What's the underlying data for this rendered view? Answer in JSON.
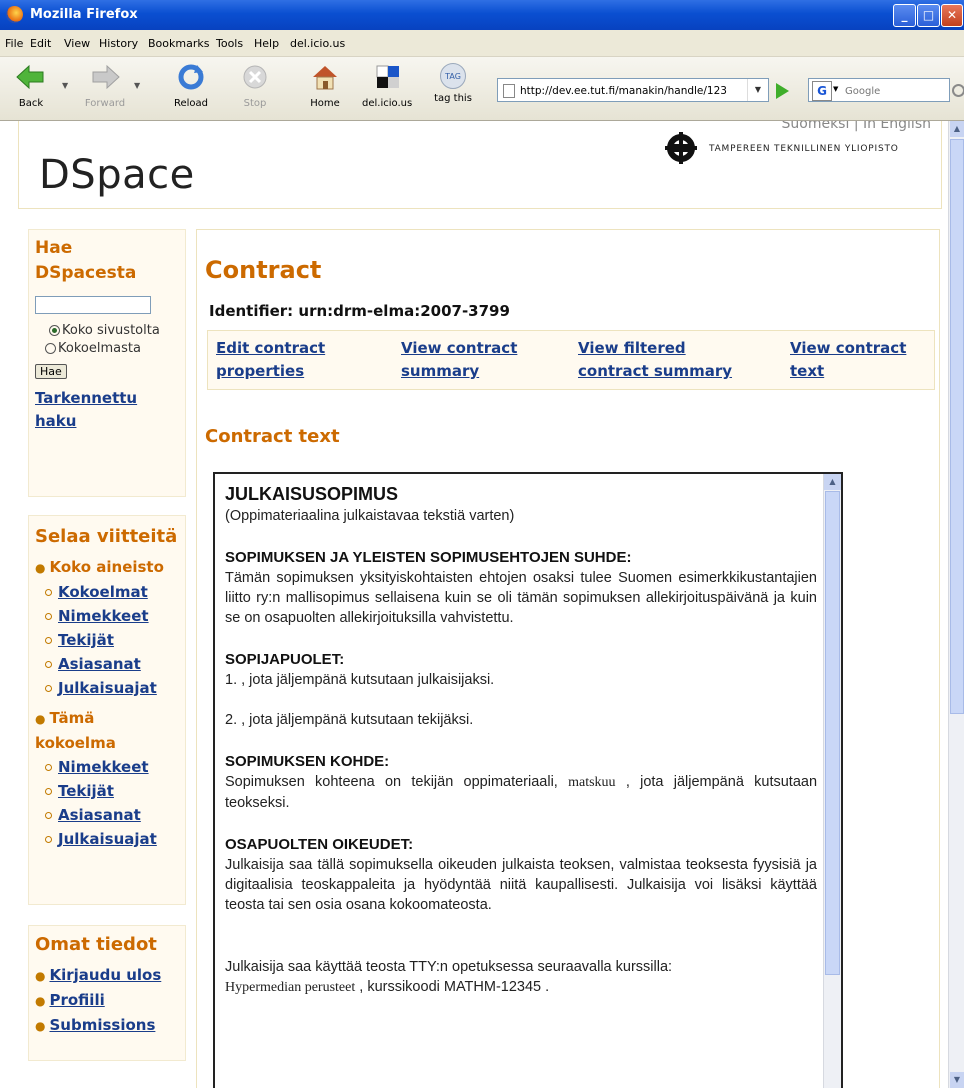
{
  "window": {
    "title": "Mozilla Firefox"
  },
  "menu": [
    "File",
    "Edit",
    "View",
    "History",
    "Bookmarks",
    "Tools",
    "Help",
    "del.icio.us"
  ],
  "toolbar": {
    "back": "Back",
    "forward": "Forward",
    "reload": "Reload",
    "stop": "Stop",
    "home": "Home",
    "delicious": "del.icio.us",
    "tag": "tag this",
    "tag_icon_text": "TAG",
    "url": "http://dev.ee.tut.fi/manakin/handle/123",
    "search_placeholder": "Google",
    "search_engine_letter": "G"
  },
  "header": {
    "languages": "Suomeksi | In English",
    "site_name": "DSpace",
    "institution": "TAMPEREEN TEKNILLINEN YLIOPISTO"
  },
  "sidebar": {
    "search": {
      "title": "Hae DSpacesta",
      "option_all": "Koko sivustolta",
      "option_collection": "Kokoelmasta",
      "button": "Hae",
      "advanced": "Tarkennettu haku"
    },
    "browse": {
      "title": "Selaa viitteitä",
      "groups": [
        {
          "label": "Koko aineisto",
          "items": [
            "Kokoelmat",
            "Nimekkeet",
            "Tekijät",
            "Asiasanat",
            "Julkaisuajat"
          ]
        },
        {
          "label": "Tämä kokoelma",
          "items": [
            "Nimekkeet",
            "Tekijät",
            "Asiasanat",
            "Julkaisuajat"
          ]
        }
      ]
    },
    "account": {
      "title": "Omat tiedot",
      "items": [
        "Kirjaudu ulos",
        "Profiili",
        "Submissions"
      ]
    }
  },
  "main": {
    "title": "Contract",
    "identifier": "Identifier: urn:drm-elma:2007-3799",
    "actions": {
      "edit": "Edit contract properties",
      "summary": "View contract summary",
      "filtered": "View filtered contract summary",
      "text": "View contract text"
    },
    "section_title": "Contract text",
    "document": {
      "title": "JULKAISUSOPIMUS",
      "subtitle": "(Oppimateriaalina julkaistavaa tekstiä varten)",
      "sec1_head": "SOPIMUKSEN JA YLEISTEN SOPIMUSEHTOJEN SUHDE:",
      "sec1_body": "Tämän sopimuksen yksityiskohtaisten ehtojen osaksi tulee Suomen esimerkkikustantajien liitto ry:n mallisopimus sellaisena kuin se oli tämän sopimuksen allekirjoituspäivänä ja kuin se on osapuolten allekirjoituksilla vahvistettu.",
      "sec2_head": "SOPIJAPUOLET:",
      "sec2_line1": "1. , jota jäljempänä kutsutaan julkaisijaksi.",
      "sec2_line2": "2. , jota jäljempänä kutsutaan tekijäksi.",
      "sec3_head": "SOPIMUKSEN KOHDE:",
      "sec3_pre": "Sopimuksen kohteena on tekijän oppimateriaali,",
      "sec3_name": "matskuu",
      "sec3_post": ", jota jäljempänä kutsutaan teokseksi.",
      "sec4_head": "OSAPUOLTEN OIKEUDET:",
      "sec4_body": "Julkaisija saa tällä sopimuksella oikeuden julkaista teoksen, valmistaa teoksesta fyysisiä ja digitaalisia teoskappaleita ja hyödyntää niitä kaupallisesti. Julkaisija voi lisäksi käyttää teosta tai sen osia osana kokoomateosta.",
      "sec5_line1": "Julkaisija saa käyttää teosta TTY:n opetuksessa seuraavalla kurssilla:",
      "sec5_course": "Hypermedian perusteet",
      "sec5_code": ", kurssikoodi MATHM-12345 ."
    }
  }
}
